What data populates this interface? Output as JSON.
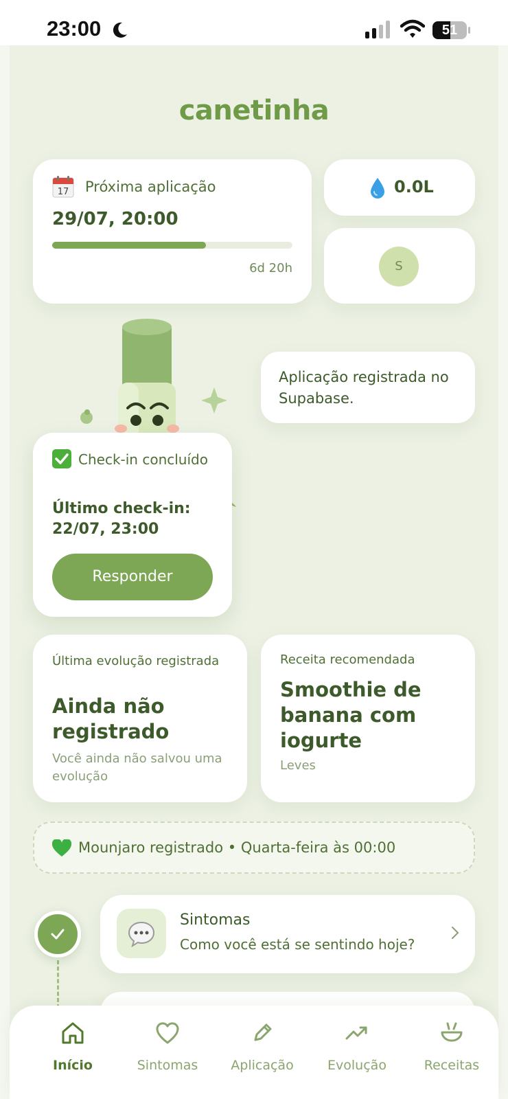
{
  "status_bar": {
    "time": "23:00",
    "battery": "51",
    "icons": [
      "moon-icon",
      "signal-icon",
      "wifi-icon",
      "battery-icon"
    ]
  },
  "app": {
    "brand": "canetinha",
    "next_application": {
      "label": "Próxima aplicação",
      "date": "29/07, 20:00",
      "progress": 0.64,
      "remaining": "6d 20h"
    },
    "water": {
      "value": "0.0L"
    },
    "avatar": {
      "initial": "S"
    },
    "bubble": {
      "text": "Aplicação registrada no Supabase."
    },
    "checkin": {
      "status": "Check-in concluído",
      "last": "Último check-in: 22/07, 23:00",
      "button": "Responder"
    },
    "evolution": {
      "label": "Última evolução registrada",
      "value": "Ainda não registrado",
      "sub": "Você ainda não salvou uma evolução"
    },
    "recipe": {
      "label": "Receita recomendada",
      "value": "Smoothie de banana com iogurte",
      "sub": "Leves"
    },
    "banner": {
      "text": "Mounjaro registrado • Quarta-feira às 00:00"
    },
    "symptoms": {
      "title": "Sintomas",
      "subtitle": "Como você está se sentindo hoje?"
    }
  },
  "colors": {
    "accent": "#7da655",
    "brand": "#6f9a48",
    "text_dark": "#3d5a2a",
    "background": "#ecf1e4"
  },
  "nav": {
    "items": [
      {
        "label": "Início",
        "icon": "home-icon",
        "active": true
      },
      {
        "label": "Sintomas",
        "icon": "heart-outline-icon",
        "active": false
      },
      {
        "label": "Aplicação",
        "icon": "pencil-icon",
        "active": false
      },
      {
        "label": "Evolução",
        "icon": "trending-up-icon",
        "active": false
      },
      {
        "label": "Receitas",
        "icon": "bowl-icon",
        "active": false
      }
    ]
  }
}
